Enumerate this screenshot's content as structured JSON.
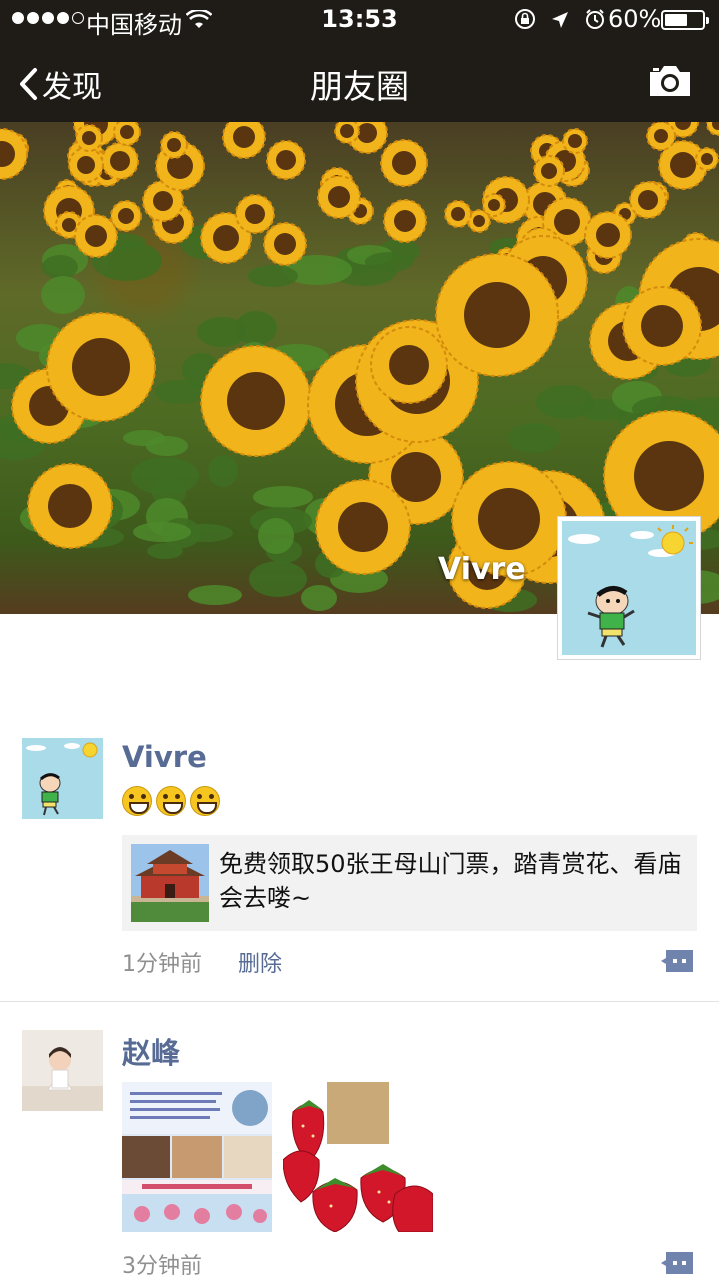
{
  "status_bar": {
    "carrier": "中国移动",
    "time": "13:53",
    "battery": "60%",
    "battery_level": 0.6
  },
  "nav": {
    "back_label": "发现",
    "title": "朋友圈"
  },
  "cover": {
    "user_name": "Vivre"
  },
  "posts": [
    {
      "author": "Vivre",
      "emoji_count": 3,
      "link_title": "免费领取50张王母山门票，踏青赏花、看庙会去喽~",
      "time": "1分钟前",
      "delete_label": "删除"
    },
    {
      "author": "赵峰",
      "time": "3分钟前"
    }
  ],
  "colors": {
    "link_blue": "#576b95",
    "nav_bg": "#1f1c17",
    "card_bg": "#f2f2f3"
  },
  "icons": [
    "wifi-icon",
    "lock-rotation-icon",
    "location-arrow-icon",
    "alarm-icon",
    "battery-icon",
    "chevron-left-icon",
    "camera-icon",
    "comment-icon"
  ]
}
